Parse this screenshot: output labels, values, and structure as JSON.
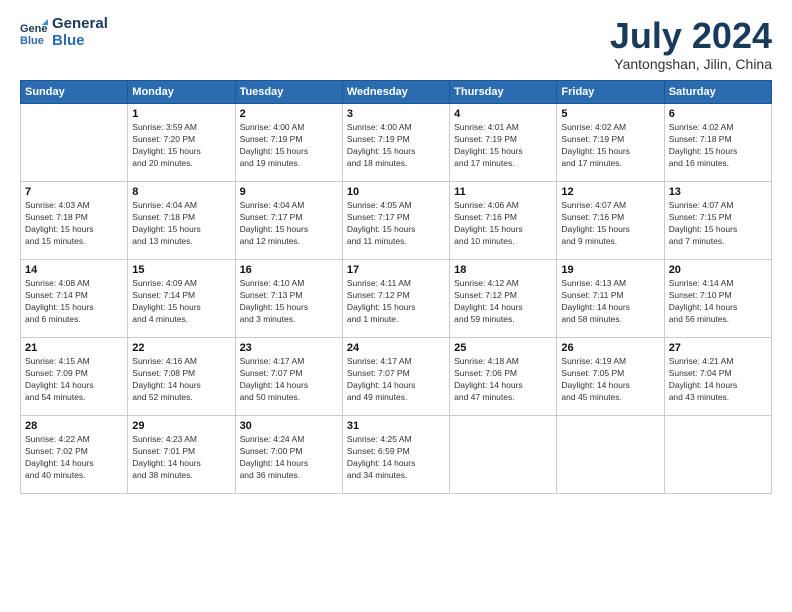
{
  "header": {
    "logo_line1": "General",
    "logo_line2": "Blue",
    "month": "July 2024",
    "location": "Yantongshan, Jilin, China"
  },
  "days_of_week": [
    "Sunday",
    "Monday",
    "Tuesday",
    "Wednesday",
    "Thursday",
    "Friday",
    "Saturday"
  ],
  "weeks": [
    [
      {
        "num": "",
        "text": ""
      },
      {
        "num": "1",
        "text": "Sunrise: 3:59 AM\nSunset: 7:20 PM\nDaylight: 15 hours\nand 20 minutes."
      },
      {
        "num": "2",
        "text": "Sunrise: 4:00 AM\nSunset: 7:19 PM\nDaylight: 15 hours\nand 19 minutes."
      },
      {
        "num": "3",
        "text": "Sunrise: 4:00 AM\nSunset: 7:19 PM\nDaylight: 15 hours\nand 18 minutes."
      },
      {
        "num": "4",
        "text": "Sunrise: 4:01 AM\nSunset: 7:19 PM\nDaylight: 15 hours\nand 17 minutes."
      },
      {
        "num": "5",
        "text": "Sunrise: 4:02 AM\nSunset: 7:19 PM\nDaylight: 15 hours\nand 17 minutes."
      },
      {
        "num": "6",
        "text": "Sunrise: 4:02 AM\nSunset: 7:18 PM\nDaylight: 15 hours\nand 16 minutes."
      }
    ],
    [
      {
        "num": "7",
        "text": "Sunrise: 4:03 AM\nSunset: 7:18 PM\nDaylight: 15 hours\nand 15 minutes."
      },
      {
        "num": "8",
        "text": "Sunrise: 4:04 AM\nSunset: 7:18 PM\nDaylight: 15 hours\nand 13 minutes."
      },
      {
        "num": "9",
        "text": "Sunrise: 4:04 AM\nSunset: 7:17 PM\nDaylight: 15 hours\nand 12 minutes."
      },
      {
        "num": "10",
        "text": "Sunrise: 4:05 AM\nSunset: 7:17 PM\nDaylight: 15 hours\nand 11 minutes."
      },
      {
        "num": "11",
        "text": "Sunrise: 4:06 AM\nSunset: 7:16 PM\nDaylight: 15 hours\nand 10 minutes."
      },
      {
        "num": "12",
        "text": "Sunrise: 4:07 AM\nSunset: 7:16 PM\nDaylight: 15 hours\nand 9 minutes."
      },
      {
        "num": "13",
        "text": "Sunrise: 4:07 AM\nSunset: 7:15 PM\nDaylight: 15 hours\nand 7 minutes."
      }
    ],
    [
      {
        "num": "14",
        "text": "Sunrise: 4:08 AM\nSunset: 7:14 PM\nDaylight: 15 hours\nand 6 minutes."
      },
      {
        "num": "15",
        "text": "Sunrise: 4:09 AM\nSunset: 7:14 PM\nDaylight: 15 hours\nand 4 minutes."
      },
      {
        "num": "16",
        "text": "Sunrise: 4:10 AM\nSunset: 7:13 PM\nDaylight: 15 hours\nand 3 minutes."
      },
      {
        "num": "17",
        "text": "Sunrise: 4:11 AM\nSunset: 7:12 PM\nDaylight: 15 hours\nand 1 minute."
      },
      {
        "num": "18",
        "text": "Sunrise: 4:12 AM\nSunset: 7:12 PM\nDaylight: 14 hours\nand 59 minutes."
      },
      {
        "num": "19",
        "text": "Sunrise: 4:13 AM\nSunset: 7:11 PM\nDaylight: 14 hours\nand 58 minutes."
      },
      {
        "num": "20",
        "text": "Sunrise: 4:14 AM\nSunset: 7:10 PM\nDaylight: 14 hours\nand 56 minutes."
      }
    ],
    [
      {
        "num": "21",
        "text": "Sunrise: 4:15 AM\nSunset: 7:09 PM\nDaylight: 14 hours\nand 54 minutes."
      },
      {
        "num": "22",
        "text": "Sunrise: 4:16 AM\nSunset: 7:08 PM\nDaylight: 14 hours\nand 52 minutes."
      },
      {
        "num": "23",
        "text": "Sunrise: 4:17 AM\nSunset: 7:07 PM\nDaylight: 14 hours\nand 50 minutes."
      },
      {
        "num": "24",
        "text": "Sunrise: 4:17 AM\nSunset: 7:07 PM\nDaylight: 14 hours\nand 49 minutes."
      },
      {
        "num": "25",
        "text": "Sunrise: 4:18 AM\nSunset: 7:06 PM\nDaylight: 14 hours\nand 47 minutes."
      },
      {
        "num": "26",
        "text": "Sunrise: 4:19 AM\nSunset: 7:05 PM\nDaylight: 14 hours\nand 45 minutes."
      },
      {
        "num": "27",
        "text": "Sunrise: 4:21 AM\nSunset: 7:04 PM\nDaylight: 14 hours\nand 43 minutes."
      }
    ],
    [
      {
        "num": "28",
        "text": "Sunrise: 4:22 AM\nSunset: 7:02 PM\nDaylight: 14 hours\nand 40 minutes."
      },
      {
        "num": "29",
        "text": "Sunrise: 4:23 AM\nSunset: 7:01 PM\nDaylight: 14 hours\nand 38 minutes."
      },
      {
        "num": "30",
        "text": "Sunrise: 4:24 AM\nSunset: 7:00 PM\nDaylight: 14 hours\nand 36 minutes."
      },
      {
        "num": "31",
        "text": "Sunrise: 4:25 AM\nSunset: 6:59 PM\nDaylight: 14 hours\nand 34 minutes."
      },
      {
        "num": "",
        "text": ""
      },
      {
        "num": "",
        "text": ""
      },
      {
        "num": "",
        "text": ""
      }
    ]
  ]
}
